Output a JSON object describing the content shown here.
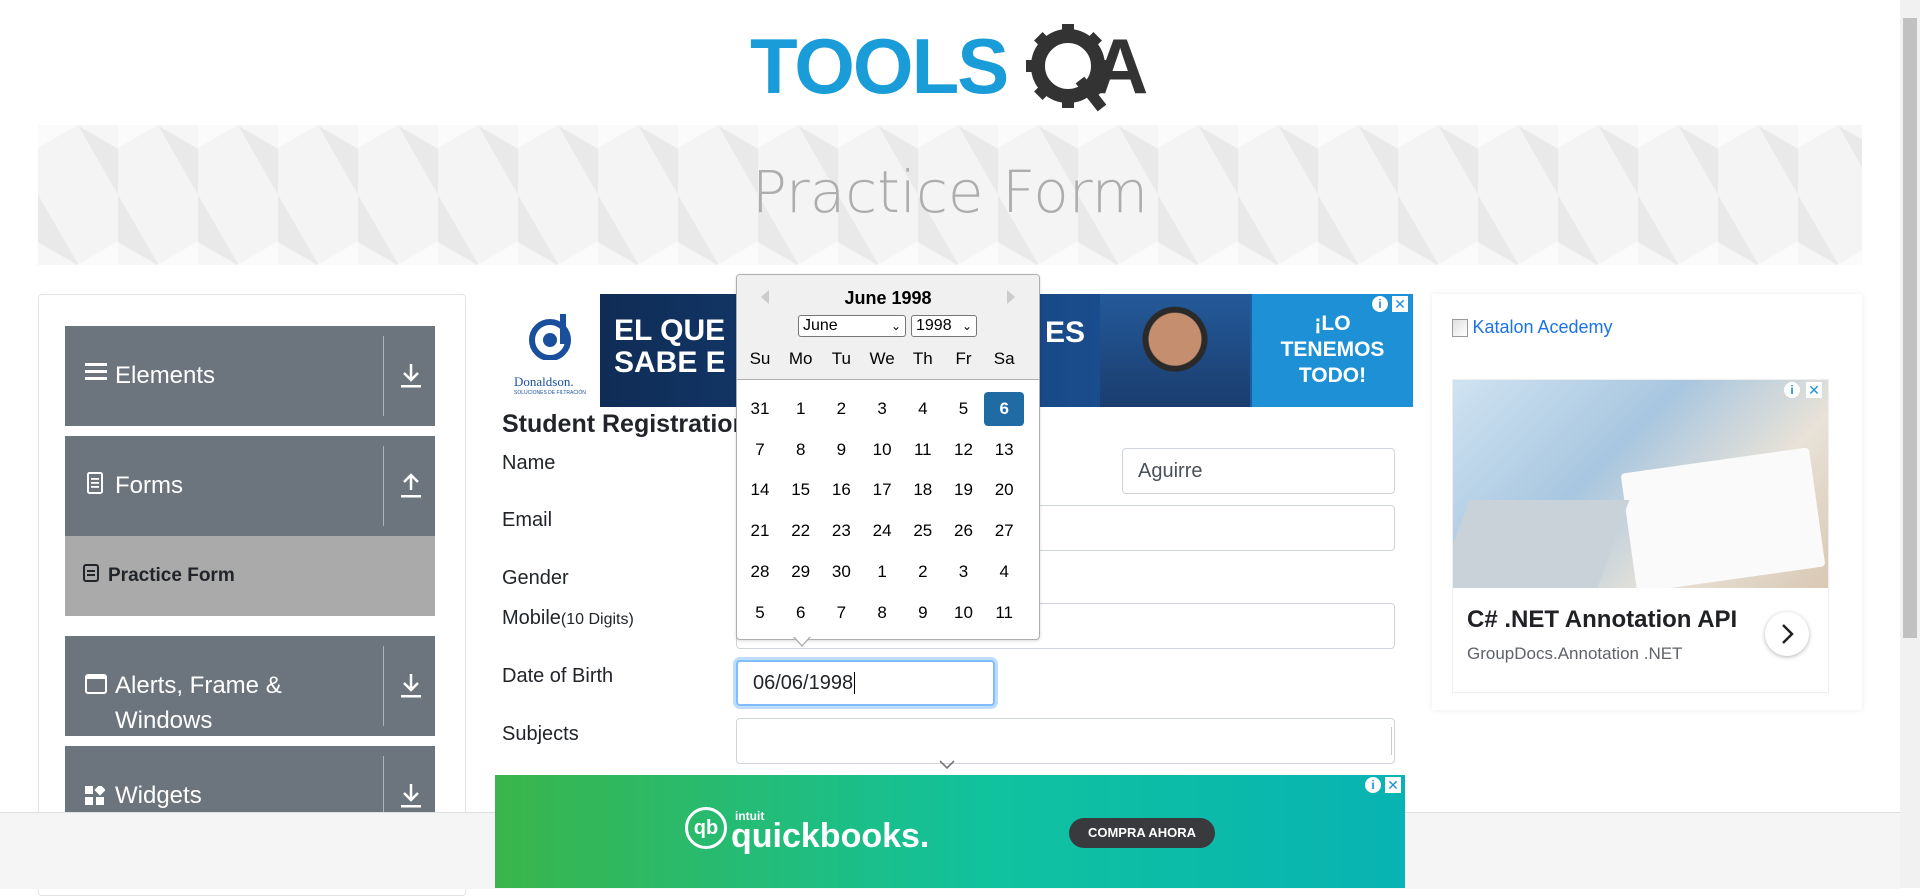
{
  "logo": {
    "text_left": "TOOLS",
    "text_right": "A"
  },
  "page_title": "Practice Form",
  "sidebar": {
    "groups": [
      {
        "label": "Elements",
        "icon": "hamburger-icon",
        "arrow": "download-arrow-icon"
      },
      {
        "label": "Forms",
        "icon": "document-icon",
        "arrow": "upload-arrow-icon"
      },
      {
        "label": "Alerts, Frame &",
        "label2": "Windows",
        "icon": "window-icon",
        "arrow": "download-arrow-icon"
      },
      {
        "label": "Widgets",
        "icon": "widgets-icon",
        "arrow": "download-arrow-icon"
      }
    ],
    "active_item": "Practice Form"
  },
  "top_ad": {
    "brand": "Donaldson.",
    "brand_sub": "SOLUCIONES DE FILTRACIÓN",
    "headline_1": "EL QUE",
    "headline_2": "SABE E",
    "partial": "ES",
    "cta_1": "¡LO",
    "cta_2": "TENEMOS",
    "cta_3": "TODO!"
  },
  "form": {
    "section_title": "Student Registration",
    "name_label": "Name",
    "last_name_value": "Aguirre",
    "email_label": "Email",
    "gender_label": "Gender",
    "mobile_label": "Mobile",
    "mobile_hint": "(10 Digits)",
    "dob_label": "Date of Birth",
    "dob_value": "06/06/1998",
    "subjects_label": "Subjects"
  },
  "calendar": {
    "title": "June 1998",
    "month_select": "June",
    "year_select": "1998",
    "day_names": [
      "Su",
      "Mo",
      "Tu",
      "We",
      "Th",
      "Fr",
      "Sa"
    ],
    "weeks": [
      [
        "31",
        "1",
        "2",
        "3",
        "4",
        "5",
        "6"
      ],
      [
        "7",
        "8",
        "9",
        "10",
        "11",
        "12",
        "13"
      ],
      [
        "14",
        "15",
        "16",
        "17",
        "18",
        "19",
        "20"
      ],
      [
        "21",
        "22",
        "23",
        "24",
        "25",
        "26",
        "27"
      ],
      [
        "28",
        "29",
        "30",
        "1",
        "2",
        "3",
        "4"
      ],
      [
        "5",
        "6",
        "7",
        "8",
        "9",
        "10",
        "11"
      ]
    ],
    "selected_day": "6"
  },
  "right_ad": {
    "katalon_alt": "Katalon Acedemy",
    "title": "C# .NET Annotation API",
    "subtitle": "GroupDocs.Annotation .NET"
  },
  "bottom_ad": {
    "brand_small": "intuit",
    "brand": "quickbooks.",
    "cta": "COMPRA AHORA"
  },
  "colors": {
    "sidebar_group": "#6c757d",
    "active_item_bg": "#aaaaaa",
    "selected_day": "#216ba5",
    "logo_blue": "#1a9cd8",
    "logo_dark": "#333333"
  }
}
